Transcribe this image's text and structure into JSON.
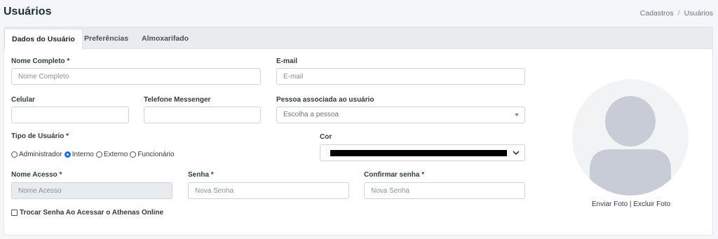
{
  "page": {
    "title": "Usuários"
  },
  "breadcrumb": {
    "items": [
      "Cadastros",
      "Usuários"
    ],
    "separator": "/"
  },
  "tabs": [
    {
      "label": "Dados do Usuário",
      "active": true
    },
    {
      "label": "Preferências",
      "active": false
    },
    {
      "label": "Almoxarifado",
      "active": false
    }
  ],
  "form": {
    "nome_completo": {
      "label": "Nome Completo *",
      "placeholder": "Nome Completo",
      "value": ""
    },
    "email": {
      "label": "E-mail",
      "placeholder": "E-mail",
      "value": ""
    },
    "celular": {
      "label": "Celular",
      "value": ""
    },
    "telefone_messenger": {
      "label": "Telefone Messenger",
      "value": ""
    },
    "pessoa": {
      "label": "Pessoa associada ao usuário",
      "placeholder": "Escolha a pessoa"
    },
    "tipo_usuario": {
      "label": "Tipo de Usuário *",
      "options": [
        "Administrador",
        "Interno",
        "Externo",
        "Funcionário"
      ],
      "selected": "Interno"
    },
    "cor": {
      "label": "Cor",
      "value": "#000000"
    },
    "nome_acesso": {
      "label": "Nome Acesso *",
      "placeholder": "Nome Acesso",
      "value": ""
    },
    "senha": {
      "label": "Senha *",
      "placeholder": "Nova Senha",
      "value": ""
    },
    "confirmar_senha": {
      "label": "Confirmar senha *",
      "placeholder": "Nova Senha",
      "value": ""
    },
    "trocar_senha": {
      "label": "Trocar Senha Ao Acessar o Athenas Online",
      "checked": false
    }
  },
  "photo": {
    "upload_label": "Enviar Foto",
    "separator": "|",
    "delete_label": "Excluir Foto",
    "avatar_color": "#c8ccd6"
  }
}
